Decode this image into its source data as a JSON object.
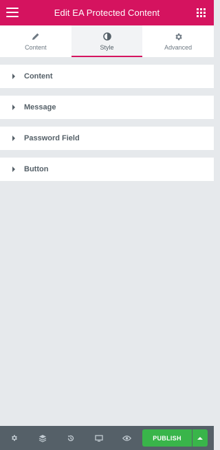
{
  "header": {
    "title": "Edit EA Protected Content",
    "menu_icon": "hamburger-icon",
    "widgets_icon": "grid-icon"
  },
  "tabs": [
    {
      "label": "Content",
      "icon": "pencil-icon",
      "active": false
    },
    {
      "label": "Style",
      "icon": "half-circle-icon",
      "active": true
    },
    {
      "label": "Advanced",
      "icon": "gear-icon",
      "active": false
    }
  ],
  "sections": [
    {
      "label": "Content"
    },
    {
      "label": "Message"
    },
    {
      "label": "Password Field"
    },
    {
      "label": "Button"
    }
  ],
  "footer": {
    "icons": [
      "settings-icon",
      "navigator-layers-icon",
      "history-icon",
      "responsive-desktop-icon",
      "preview-eye-icon"
    ],
    "publish_label": "PUBLISH"
  },
  "colors": {
    "accent": "#d5135f",
    "publish": "#39b54a",
    "footer_bg": "#556068",
    "panel_bg": "#e6e9ec"
  }
}
